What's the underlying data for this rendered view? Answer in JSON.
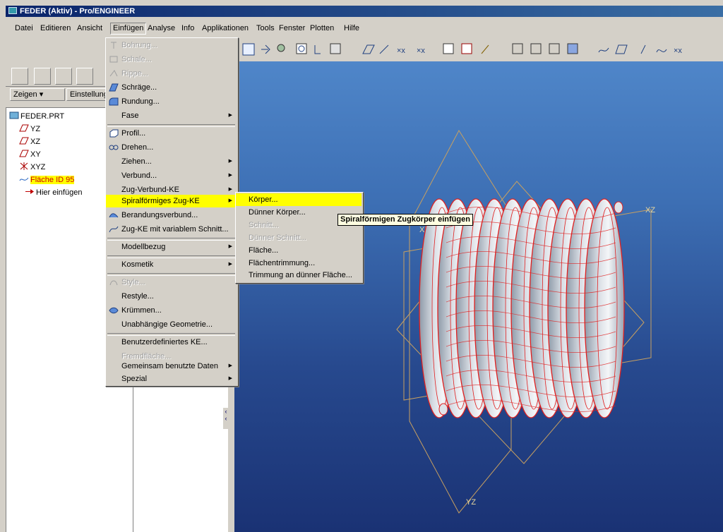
{
  "window": {
    "title": "FEDER (Aktiv) - Pro/ENGINEER"
  },
  "menubar": {
    "items": [
      {
        "label": "Datei"
      },
      {
        "label": "Editieren"
      },
      {
        "label": "Ansicht"
      },
      {
        "label": "Einfügen"
      },
      {
        "label": "Analyse"
      },
      {
        "label": "Info"
      },
      {
        "label": "Applikationen"
      },
      {
        "label": "Tools"
      },
      {
        "label": "Fenster"
      },
      {
        "label": "Plotten"
      },
      {
        "label": "Hilfe"
      }
    ]
  },
  "left_panel": {
    "zeigen_label": "Zeigen ▾",
    "einstellungen_label": "Einstellung"
  },
  "tree": {
    "items": [
      {
        "label": "FEDER.PRT",
        "icon": "part-icon"
      },
      {
        "label": "YZ",
        "icon": "datum-plane-icon"
      },
      {
        "label": "XZ",
        "icon": "datum-plane-icon"
      },
      {
        "label": "XY",
        "icon": "datum-plane-icon"
      },
      {
        "label": "XYZ",
        "icon": "coordinate-system-icon"
      },
      {
        "label": "Fläche ID 95",
        "icon": "surface-icon",
        "highlight": "#ffff00"
      },
      {
        "label": "Hier einfügen",
        "icon": "insert-arrow-icon"
      }
    ]
  },
  "einfuegen_menu": {
    "items": [
      {
        "label": "Bohrung...",
        "disabled": true,
        "icon": "hole-icon"
      },
      {
        "label": "Schale...",
        "disabled": true,
        "icon": "shell-icon"
      },
      {
        "label": "Rippe...",
        "disabled": true,
        "icon": "rib-icon"
      },
      {
        "label": "Schräge...",
        "disabled": false,
        "icon": "draft-icon"
      },
      {
        "label": "Rundung...",
        "disabled": false,
        "icon": "round-icon"
      },
      {
        "label": "Fase",
        "disabled": false,
        "submenu": true
      },
      {
        "label": "Profil...",
        "disabled": false,
        "icon": "extrude-icon"
      },
      {
        "label": "Drehen...",
        "disabled": false,
        "icon": "revolve-icon"
      },
      {
        "label": "Ziehen...",
        "disabled": false,
        "submenu": true
      },
      {
        "label": "Verbund...",
        "disabled": false,
        "submenu": true
      },
      {
        "label": "Zug-Verbund-KE",
        "disabled": false,
        "submenu": true
      },
      {
        "label": "Spiralförmiges Zug-KE",
        "disabled": false,
        "submenu": true,
        "highlighted": true
      },
      {
        "label": "Berandungsverbund...",
        "disabled": false,
        "icon": "boundary-blend-icon"
      },
      {
        "label": "Zug-KE mit variablem Schnitt...",
        "disabled": false,
        "icon": "variable-sweep-icon"
      },
      {
        "label": "Modellbezug",
        "disabled": false,
        "submenu": true
      },
      {
        "label": "Kosmetik",
        "disabled": false,
        "submenu": true
      },
      {
        "label": "Style...",
        "disabled": true,
        "icon": "style-icon"
      },
      {
        "label": "Restyle...",
        "disabled": false
      },
      {
        "label": "Krümmen...",
        "disabled": false,
        "icon": "warp-icon"
      },
      {
        "label": "Unabhängige Geometrie...",
        "disabled": false
      },
      {
        "label": "Benutzerdefiniertes KE...",
        "disabled": false
      },
      {
        "label": "Fremdfläche...",
        "disabled": true
      },
      {
        "label": "Gemeinsam benutzte Daten",
        "disabled": false,
        "submenu": true
      },
      {
        "label": "Spezial",
        "disabled": false,
        "submenu": true
      }
    ]
  },
  "spiral_submenu": {
    "items": [
      {
        "label": "Körper...",
        "disabled": false,
        "highlighted": true
      },
      {
        "label": "Dünner Körper...",
        "disabled": false
      },
      {
        "label": "Schnitt...",
        "disabled": true
      },
      {
        "label": "Dünner Schnitt...",
        "disabled": true
      },
      {
        "label": "Fläche...",
        "disabled": false
      },
      {
        "label": "Flächentrimmung...",
        "disabled": false
      },
      {
        "label": "Trimmung an dünner Fläche...",
        "disabled": false
      }
    ]
  },
  "tooltip": {
    "text": "Spiralförmigen Zugkörper einfügen"
  },
  "viewport": {
    "labels": {
      "yz": "YZ",
      "xz": "XZ",
      "xy": "XY"
    }
  },
  "colors": {
    "highlight": "#ffff00",
    "spring_wire": "#e02020",
    "title_bar": "#0a246a"
  }
}
